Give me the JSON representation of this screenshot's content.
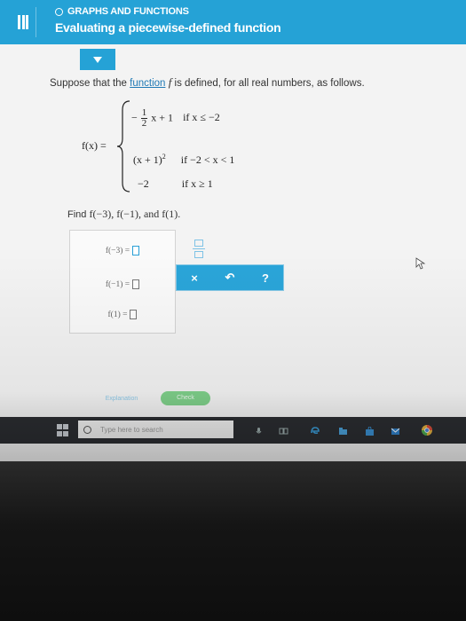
{
  "header": {
    "topic": "GRAPHS AND FUNCTIONS",
    "title": "Evaluating a piecewise-defined function"
  },
  "prompt": {
    "before": "Suppose that the ",
    "link": "function",
    "f": " f",
    "after": " is defined, for all real numbers, as follows."
  },
  "definition": {
    "lhs": "f(x) =",
    "case1": {
      "sign": "−",
      "num": "1",
      "den": "2",
      "expr": "x + 1",
      "cond": "if x ≤ −2"
    },
    "case2": {
      "expr": "(x + 1)",
      "exp": "2",
      "cond": "if −2 < x < 1"
    },
    "case3": {
      "expr": "−2",
      "cond": "if x ≥ 1"
    }
  },
  "find": {
    "label": "Find ",
    "expr": "f(−3), f(−1), and f(1)."
  },
  "answers": [
    {
      "label": "f(−3) ="
    },
    {
      "label": "f(−1) ="
    },
    {
      "label": "f(1) ="
    }
  ],
  "toolbox": {
    "clear": "×",
    "undo": "↶",
    "help": "?"
  },
  "buttons": {
    "explanation": "Explanation",
    "check": "Check"
  },
  "taskbar": {
    "search_placeholder": "Type here to search"
  }
}
